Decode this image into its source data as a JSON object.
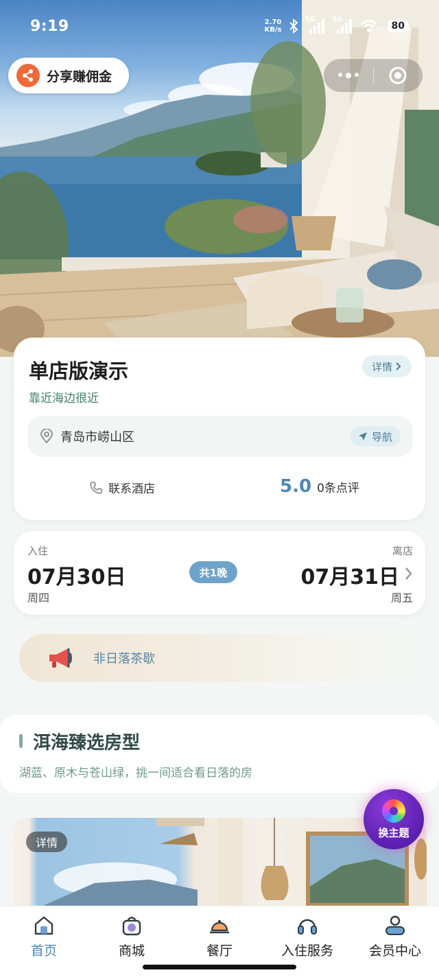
{
  "status_bar": {
    "time": "9:19",
    "speed_value": "2.70",
    "speed_unit": "KB/s",
    "net1": "5G",
    "net2": "5G",
    "battery": "80"
  },
  "share": {
    "label": "分享赚佣金"
  },
  "hotel": {
    "name": "单店版演示",
    "tagline": "靠近海边很近",
    "detail_label": "详情",
    "address": "青岛市崂山区",
    "nav_label": "导航",
    "contact_label": "联系酒店",
    "rating": "5.0",
    "review_count": "0条点评"
  },
  "stay": {
    "checkin_label": "入住",
    "checkin_date": "07月30日",
    "checkin_weekday": "周四",
    "nights": "共1晚",
    "checkout_label": "离店",
    "checkout_date": "07月31日",
    "checkout_weekday": "周五"
  },
  "notice": {
    "text": "非日落茶歇"
  },
  "section": {
    "title": "洱海臻选房型",
    "subtitle": "湖蓝、原木与苍山绿，挑一间适合看日落的房"
  },
  "room": {
    "detail_tag": "详情"
  },
  "theme_fab": {
    "label": "换主题"
  },
  "tabs": [
    {
      "label": "首页",
      "icon": "home-icon",
      "active": true
    },
    {
      "label": "商城",
      "icon": "shopping-bag-icon",
      "active": false
    },
    {
      "label": "餐厅",
      "icon": "dining-cloche-icon",
      "active": false
    },
    {
      "label": "入住服务",
      "icon": "headset-icon",
      "active": false
    },
    {
      "label": "会员中心",
      "icon": "member-user-icon",
      "active": false
    }
  ],
  "colors": {
    "accent_blue": "#4a86b8",
    "green_text": "#3f7f67",
    "share_orange": "#ee6a3a",
    "theme_purple": "#5b1fb0"
  }
}
